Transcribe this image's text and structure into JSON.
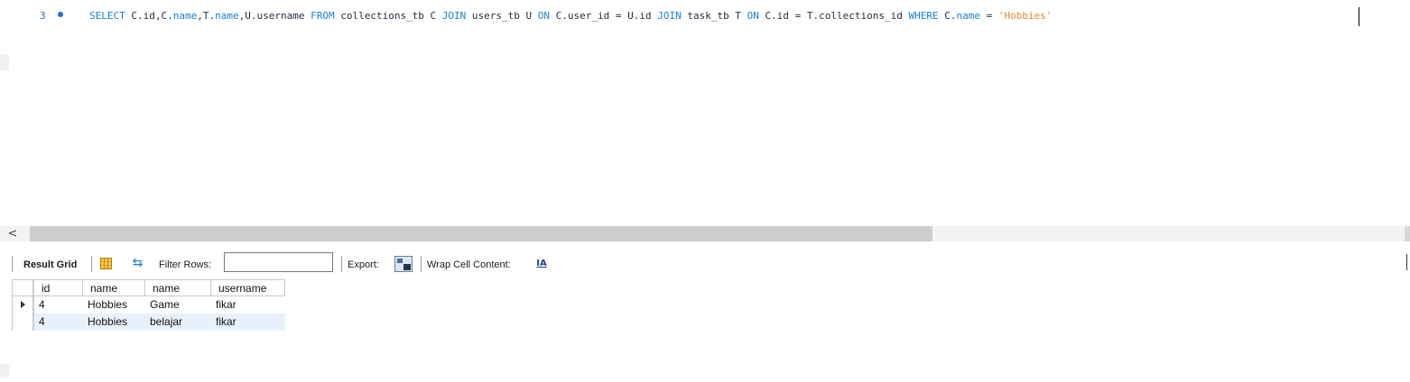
{
  "editor": {
    "line_number": "3",
    "tokens": [
      {
        "t": "SELECT",
        "k": "kw"
      },
      {
        "t": " C.id,C.",
        "k": "txt"
      },
      {
        "t": "name",
        "k": "kw"
      },
      {
        "t": ",T.",
        "k": "txt"
      },
      {
        "t": "name",
        "k": "kw"
      },
      {
        "t": ",U.username ",
        "k": "txt"
      },
      {
        "t": "FROM",
        "k": "kw"
      },
      {
        "t": " collections_tb C ",
        "k": "txt"
      },
      {
        "t": "JOIN",
        "k": "kw"
      },
      {
        "t": " users_tb U ",
        "k": "txt"
      },
      {
        "t": "ON",
        "k": "kw"
      },
      {
        "t": " C.user_id = U.id ",
        "k": "txt"
      },
      {
        "t": "JOIN",
        "k": "kw"
      },
      {
        "t": " task_tb T ",
        "k": "txt"
      },
      {
        "t": "ON",
        "k": "kw"
      },
      {
        "t": " C.id = T.collections_id ",
        "k": "txt"
      },
      {
        "t": "WHERE",
        "k": "kw"
      },
      {
        "t": " C.",
        "k": "txt"
      },
      {
        "t": "name",
        "k": "kw"
      },
      {
        "t": " = ",
        "k": "txt"
      },
      {
        "t": "'Hobbies'",
        "k": "str"
      }
    ]
  },
  "scrollbar": {
    "left_arrow": "<"
  },
  "toolbar": {
    "result_grid_label": "Result Grid",
    "filter_rows_label": "Filter Rows:",
    "filter_value": "",
    "export_label": "Export:",
    "wrap_label": "Wrap Cell Content:",
    "wrap_icon": "IA"
  },
  "grid": {
    "columns": [
      "id",
      "name",
      "name",
      "username"
    ],
    "rows": [
      [
        "4",
        "Hobbies",
        "Game",
        "fikar"
      ],
      [
        "4",
        "Hobbies",
        "belajar",
        "fikar"
      ]
    ],
    "selected_row": 0
  },
  "colors": {
    "keyword": "#1a7fd1",
    "string": "#e58a2e",
    "alt_row": "#e8f1fb"
  }
}
